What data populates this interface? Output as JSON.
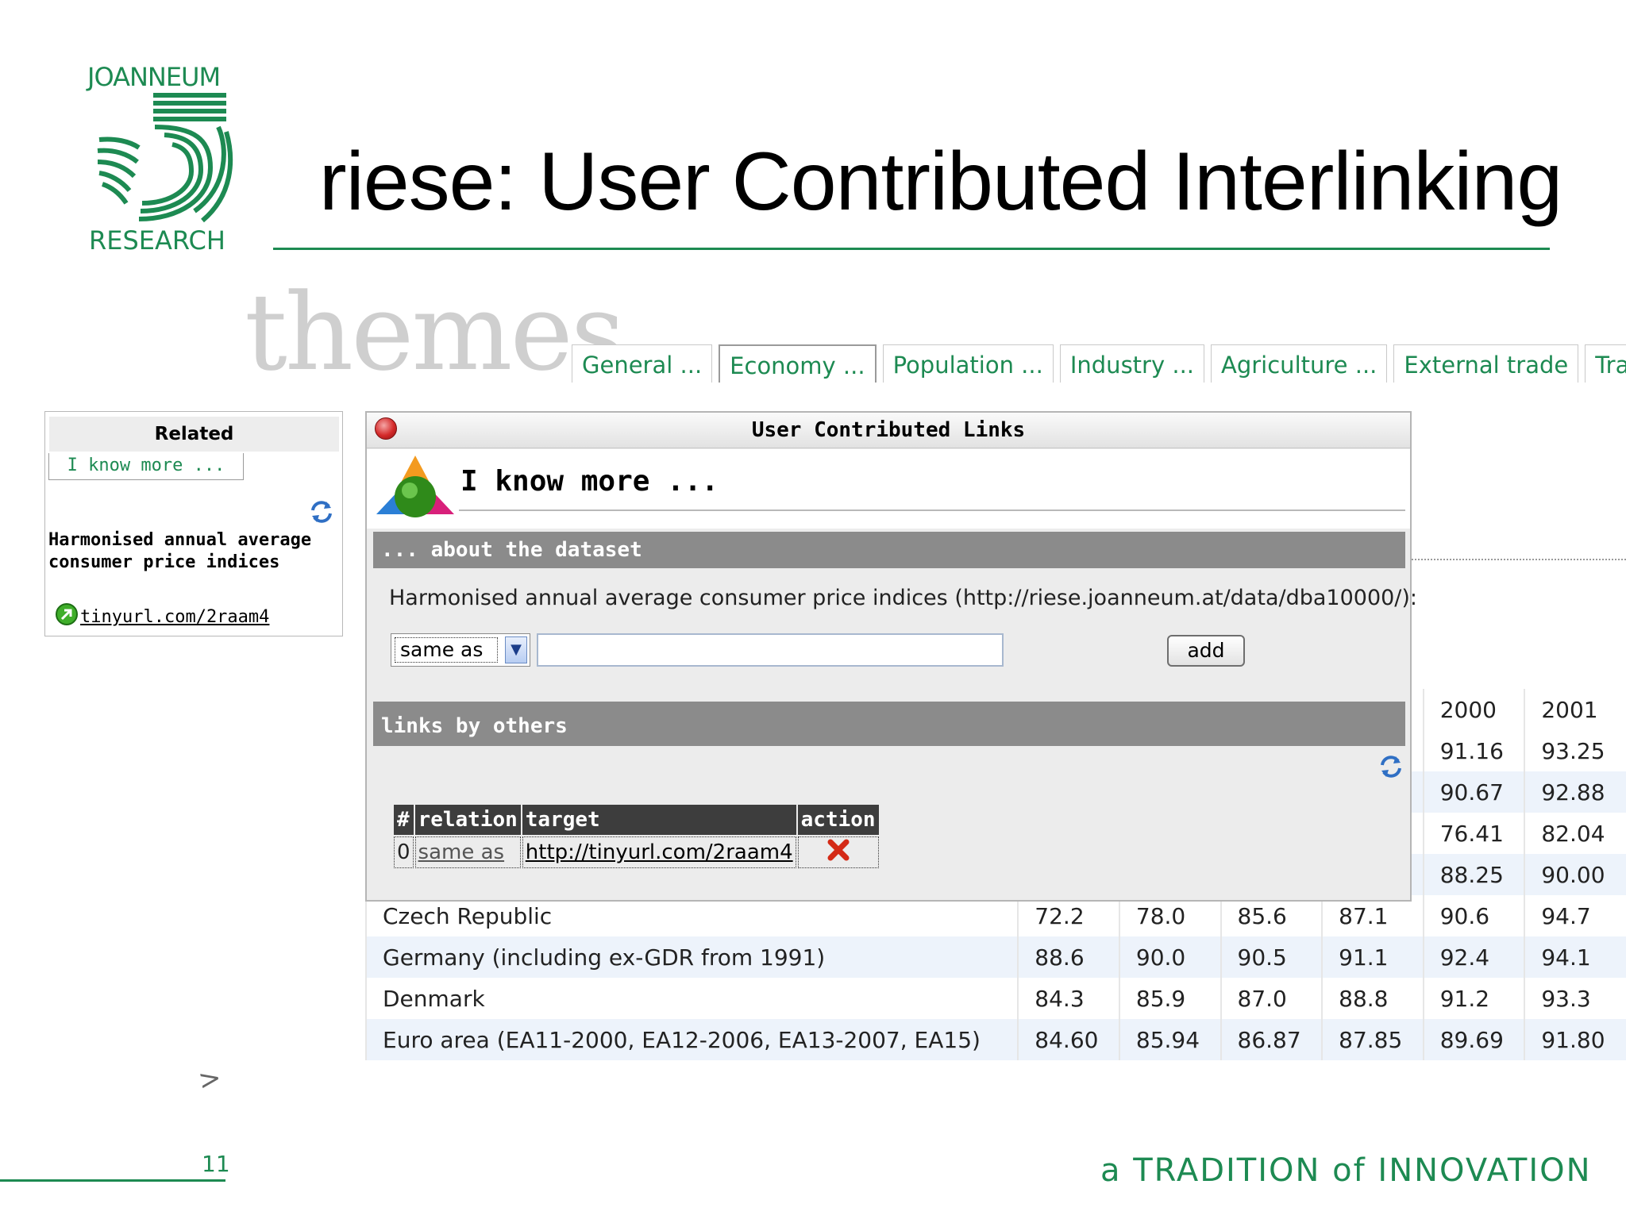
{
  "logo": {
    "top_text": "JOANNEUM",
    "bottom_text": "RESEARCH"
  },
  "slide": {
    "title": "riese: User Contributed Interlinking",
    "page_number": "11",
    "tagline": "a TRADITION of INNOVATION",
    "cursor_mark": ">"
  },
  "themes": {
    "label": "themes",
    "tabs": [
      {
        "label": "General ..."
      },
      {
        "label": "Economy ...",
        "active": true
      },
      {
        "label": "Population ..."
      },
      {
        "label": "Industry ..."
      },
      {
        "label": "Agriculture ..."
      },
      {
        "label": "External trade"
      },
      {
        "label": "Tra"
      }
    ]
  },
  "left_panel": {
    "heading": "Related",
    "tab_label": "I know more ...",
    "dataset_title": "Harmonised annual average consumer price indices",
    "dataset_link": "tinyurl.com/2raam4"
  },
  "dialog": {
    "title": "User Contributed Links",
    "heading": "I know more ...",
    "section_dataset": "... about the dataset",
    "dataset_description": "Harmonised annual average consumer price indices (http://riese.joanneum.at/data/dba10000/):",
    "relation_select": {
      "value": "same as"
    },
    "target_input": {
      "value": "",
      "placeholder": ""
    },
    "add_label": "add",
    "section_links": "links by others",
    "links_table": {
      "headers": [
        "#",
        "relation",
        "target",
        "action"
      ],
      "rows": [
        {
          "index": "0",
          "relation": "same as",
          "target": "http://tinyurl.com/2raam4"
        }
      ]
    }
  },
  "data_table": {
    "headers": [
      "2000",
      "2001"
    ],
    "partial_rows": [
      [
        "91.16",
        "93.25"
      ],
      [
        "90.67",
        "92.88"
      ],
      [
        "76.41",
        "82.04"
      ],
      [
        "88.25",
        "90.00"
      ]
    ],
    "rows": [
      {
        "country": "Czech Republic",
        "values": [
          "72.2",
          "78.0",
          "85.6",
          "87.1",
          "90.6",
          "94.7"
        ]
      },
      {
        "country": "Germany (including ex-GDR from 1991)",
        "values": [
          "88.6",
          "90.0",
          "90.5",
          "91.1",
          "92.4",
          "94.1"
        ]
      },
      {
        "country": "Denmark",
        "values": [
          "84.3",
          "85.9",
          "87.0",
          "88.8",
          "91.2",
          "93.3"
        ]
      },
      {
        "country": "Euro area (EA11-2000, EA12-2006, EA13-2007, EA15)",
        "values": [
          "84.60",
          "85.94",
          "86.87",
          "87.85",
          "89.69",
          "91.80"
        ]
      }
    ]
  },
  "colors": {
    "brand_green": "#1d8a52",
    "section_gray": "#8b8b8b",
    "row_alt": "#edf3fb"
  },
  "icons": [
    "joanneum-logo-icon",
    "close-icon",
    "orb-icon",
    "refresh-icon",
    "go-arrow-icon",
    "chevron-down-icon",
    "delete-icon"
  ]
}
